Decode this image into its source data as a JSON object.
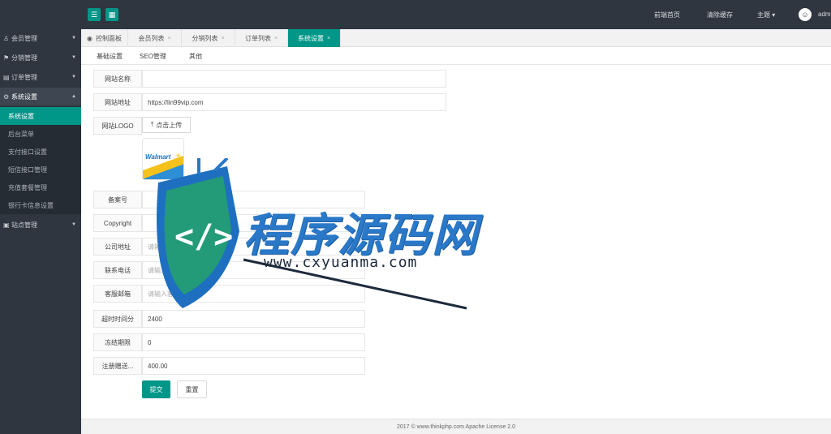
{
  "topbar": {
    "user_label": "adm"
  },
  "sidebar": {
    "items": [
      {
        "label": "会员管理"
      },
      {
        "label": "分销管理"
      },
      {
        "label": "订单管理"
      },
      {
        "label": "系统设置"
      },
      {
        "label": "站点管理"
      }
    ],
    "subitems": [
      {
        "label": "系统设置"
      },
      {
        "label": "后台菜单"
      },
      {
        "label": "支付接口设置"
      },
      {
        "label": "短信接口管理"
      },
      {
        "label": "充值套餐管理"
      },
      {
        "label": "银行卡信息设置"
      }
    ]
  },
  "tabs": [
    {
      "label": "控制面板"
    },
    {
      "label": "会员列表"
    },
    {
      "label": "分销列表"
    },
    {
      "label": "订单列表"
    },
    {
      "label": "系统设置"
    }
  ],
  "subtabs": [
    {
      "label": "基础设置"
    },
    {
      "label": "SEO管理"
    },
    {
      "label": "其他"
    }
  ],
  "form": {
    "site_name_label": "网站名称",
    "site_url_label": "网站地址",
    "site_url_value": "https://lin99vip.com",
    "logo_label": "网站LOGO",
    "upload_label": "点击上传",
    "logo_text": "Walmart",
    "icp_label": "备案号",
    "copyright_label": "Copyright",
    "address_label": "公司地址",
    "address_placeholder": "请输入公司地址",
    "phone_label": "联系电话",
    "phone_placeholder": "请输入联系电话",
    "email_label": "客服邮箱",
    "email_placeholder": "请输入客服邮箱",
    "f1_label": "超时时间分",
    "f1_value": "2400",
    "f2_label": "冻结期限",
    "f2_value": "0",
    "f3_label": "注册赠送...",
    "f3_value": "400.00",
    "submit_label": "提交",
    "reset_label": "重置"
  },
  "footer": {
    "text": "2017 © www.thinkphp.com Apache License 2.0"
  },
  "watermark": {
    "title": "程序源码网",
    "url": "www.cxyuanma.com"
  },
  "colors": {
    "accent": "#009688",
    "sidebar_bg": "#2f3640",
    "watermark_blue": "#2a78c8"
  }
}
